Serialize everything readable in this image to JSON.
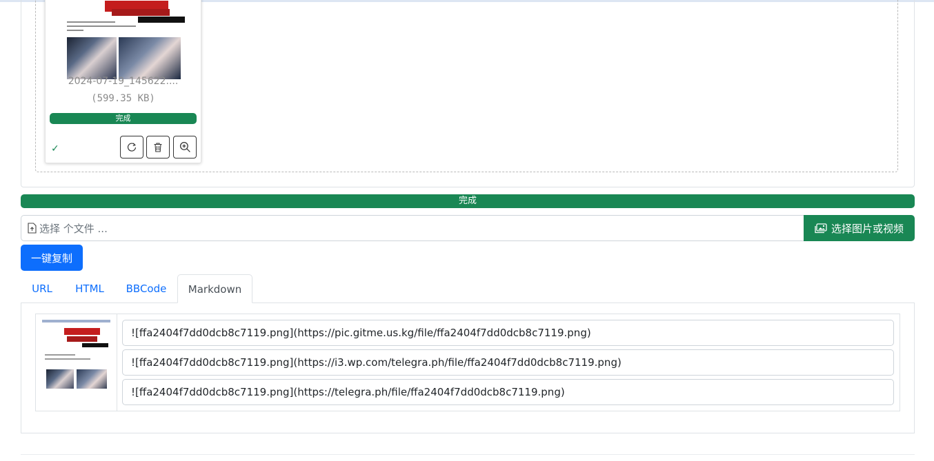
{
  "upload_card": {
    "filename": "2024-07-19_145622....",
    "filesize": "(599.35 KB)",
    "status": "完成",
    "status_color": "#198754"
  },
  "main_progress": {
    "label": "完成",
    "value_percent": 100
  },
  "file_picker": {
    "placeholder": "选择 个文件 ...",
    "button_label": "选择图片或视频"
  },
  "copy_button": {
    "label": "一键复制"
  },
  "tabs": [
    {
      "label": "URL"
    },
    {
      "label": "HTML"
    },
    {
      "label": "BBCode"
    },
    {
      "label": "Markdown"
    }
  ],
  "links": [
    "![ffa2404f7dd0dcb8c7119.png](https://pic.gitme.us.kg/file/ffa2404f7dd0dcb8c7119.png)",
    "![ffa2404f7dd0dcb8c7119.png](https://i3.wp.com/telegra.ph/file/ffa2404f7dd0dcb8c7119.png)",
    "![ffa2404f7dd0dcb8c7119.png](https://telegra.ph/file/ffa2404f7dd0dcb8c7119.png)"
  ],
  "colors": {
    "primary": "#0d6efd",
    "success": "#198754"
  }
}
